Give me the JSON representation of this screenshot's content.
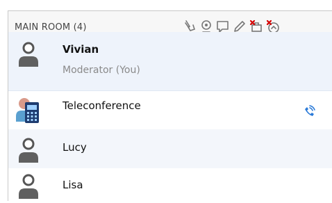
{
  "room": {
    "title": "MAIN ROOM (4)"
  },
  "toolbar": {
    "icons": [
      "raise-hand-icon",
      "webcam-icon",
      "chat-icon",
      "pencil-icon",
      "disable-camera-icon",
      "eject-icon"
    ]
  },
  "participants": [
    {
      "name": "Vivian",
      "role": "Moderator (You)",
      "avatar": "user-icon"
    },
    {
      "name": "Teleconference",
      "avatar": "phone-participant-icon",
      "status_icon": "audio-phone-icon"
    },
    {
      "name": "Lucy",
      "avatar": "user-icon"
    },
    {
      "name": "Lisa",
      "avatar": "user-icon"
    }
  ],
  "colors": {
    "selected_row": "#eef3fb",
    "phone_blue": "#2a7ad8",
    "delete_red": "#d40000"
  }
}
